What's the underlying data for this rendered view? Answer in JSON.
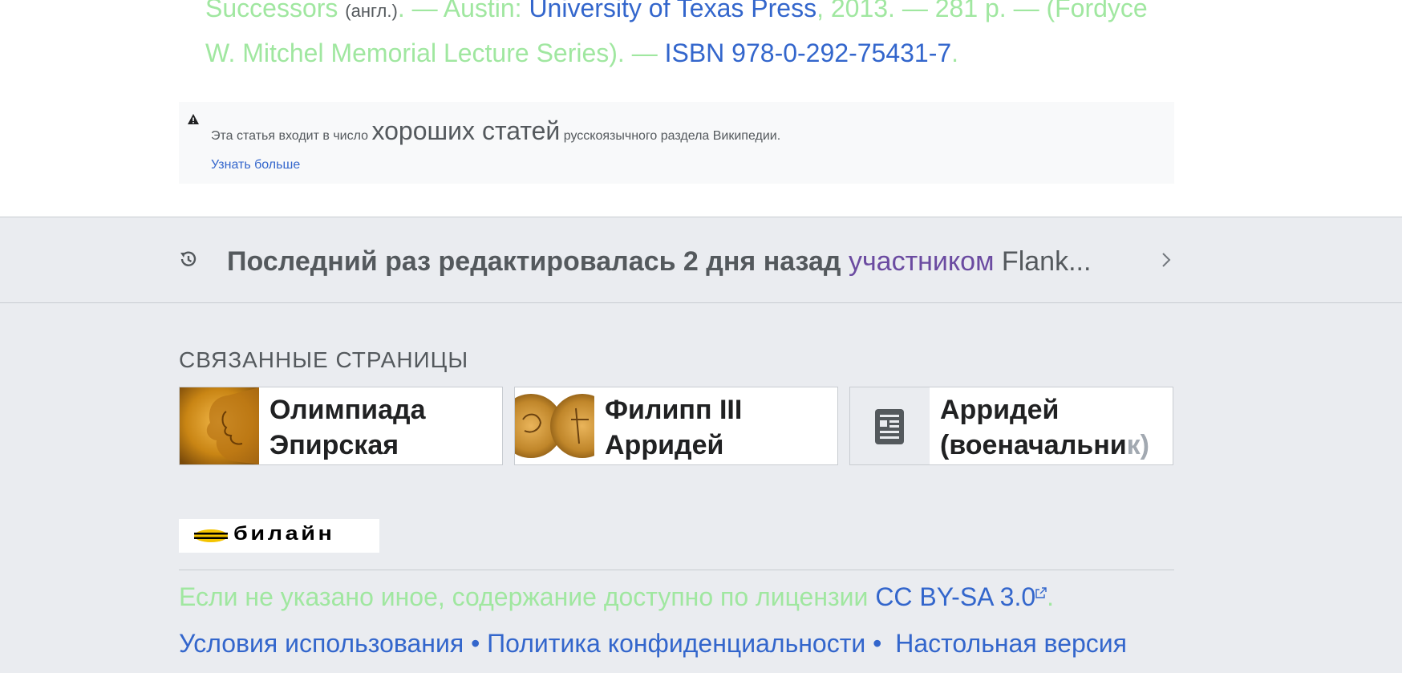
{
  "reference": {
    "line1_a": "Successors",
    "line1_lang": "(англ.)",
    "line1_b": ". — Austin: ",
    "publisher": "University of Texas Press",
    "line1_c": ", 2013. — 281 p. — (Fordyce",
    "line2_a": "W. Mitchel Memorial Lecture Series). — ",
    "isbn": "ISBN 978-0-292-75431-7",
    "line2_end": "."
  },
  "notice": {
    "pre": "Эта статья входит в число",
    "big": "хороших статей",
    "post": "русскоязычного раздела Википедии.",
    "more": "Узнать больше"
  },
  "last_edit": {
    "bold": "Последний раз редактировалась 2 дня назад",
    "by": "участником",
    "user": "Flank..."
  },
  "related": {
    "heading": "СВЯЗАННЫЕ СТРАНИЦЫ",
    "items": [
      {
        "title": "Олимпиада Эпирская"
      },
      {
        "title": "Филипп III Арридей"
      },
      {
        "title_main": "Арридей (военачальни",
        "title_fade": "к)"
      }
    ]
  },
  "sponsor": {
    "logo_text": "билайн"
  },
  "license": {
    "text": "Если не указано иное, содержание доступно по лицензии ",
    "link": "CC BY-SA 3.0",
    "end": "."
  },
  "footer": {
    "links": [
      "Условия использования",
      "Политика конфиденциальности",
      "Настольная версия"
    ],
    "separator": "•"
  },
  "colors": {
    "link": "#3366cc",
    "visited": "#6b4ba1",
    "greenish_text": "#a0e7a0",
    "background_gray": "#eaecf0"
  }
}
